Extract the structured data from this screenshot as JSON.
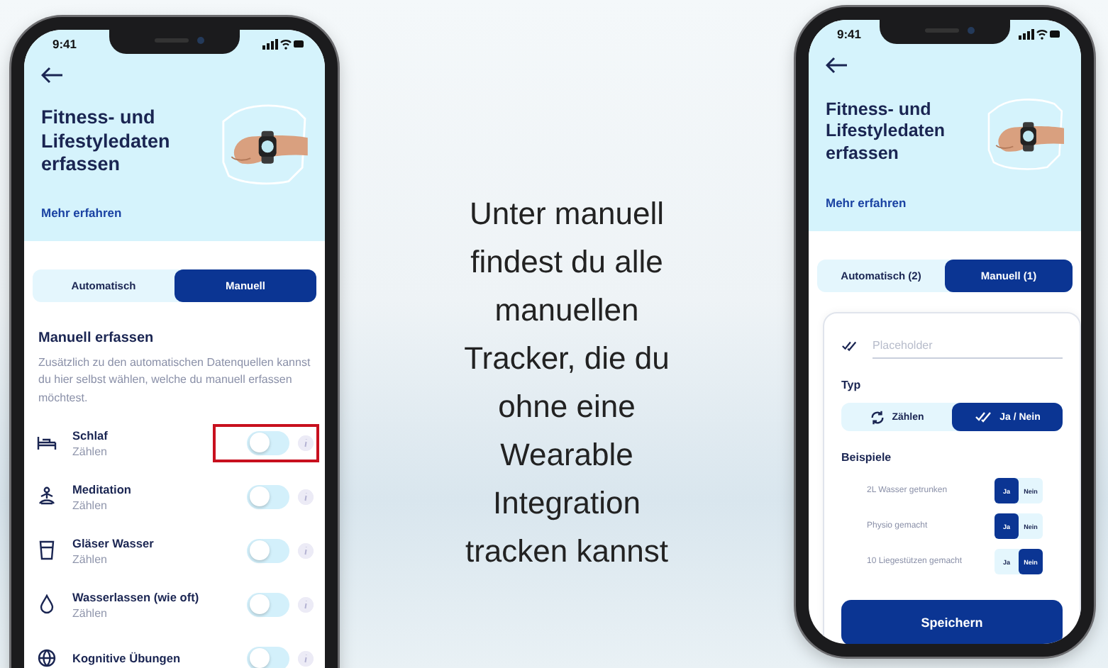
{
  "phones": [
    {
      "kind": "tracker_list",
      "status_time": "9:41",
      "title": "Fitness- und Lifestyledaten erfassen",
      "link": "Mehr erfahren",
      "tabs": [
        {
          "label": "Automatisch",
          "selected": false
        },
        {
          "label": "Manuell",
          "selected": true
        }
      ],
      "section_title": "Manuell erfassen",
      "description": "Zusätzlich zu den automatischen Datenquellen kannst du hier selbst wählen, welche du manuell erfassen möchtest.",
      "trackers": [
        {
          "kind": "bed",
          "name": "Schlaf",
          "type": "Zählen",
          "on": false,
          "highlighted": true
        },
        {
          "kind": "meditation",
          "name": "Meditation",
          "type": "Zählen",
          "on": false,
          "highlighted": false
        },
        {
          "kind": "glass",
          "name": "Gläser Wasser",
          "type": "Zählen",
          "on": false,
          "highlighted": false
        },
        {
          "kind": "drop",
          "name": "Wasserlassen (wie oft)",
          "type": "Zählen",
          "on": false,
          "highlighted": false
        },
        {
          "kind": "globe",
          "name": "Kognitive Übungen",
          "on": false,
          "highlighted": false
        }
      ]
    },
    {
      "kind": "create_tracker",
      "status_time": "9:41",
      "title": "Fitness- und Lifestyledaten erfassen",
      "link": "Mehr erfahren",
      "tabs": [
        {
          "label": "Automatisch (2)",
          "selected": false
        },
        {
          "label": "Manuell (1)",
          "selected": true
        }
      ],
      "form": {
        "name_placeholder": "Placeholder",
        "type_label": "Typ",
        "types": [
          {
            "kind": "counter",
            "label": "Zählen",
            "selected": false
          },
          {
            "kind": "check",
            "label": "Ja / Nein",
            "selected": true
          }
        ],
        "examples_label": "Beispiele",
        "examples": [
          {
            "text": "2L Wasser getrunken",
            "options": [
              {
                "label": "Ja",
                "selected": true
              },
              {
                "label": "Nein",
                "selected": false
              }
            ]
          },
          {
            "text": "Physio gemacht",
            "options": [
              {
                "label": "Ja",
                "selected": true
              },
              {
                "label": "Nein",
                "selected": false
              }
            ]
          },
          {
            "text": "10 Liegestützen gemacht",
            "options": [
              {
                "label": "Ja",
                "selected": false
              },
              {
                "label": "Nein",
                "selected": true
              }
            ]
          }
        ],
        "save_button": "Speichern"
      }
    }
  ],
  "caption": "Unter manuell findest du alle manuellen Tracker, die du ohne eine Wearable Integration tracken kannst"
}
